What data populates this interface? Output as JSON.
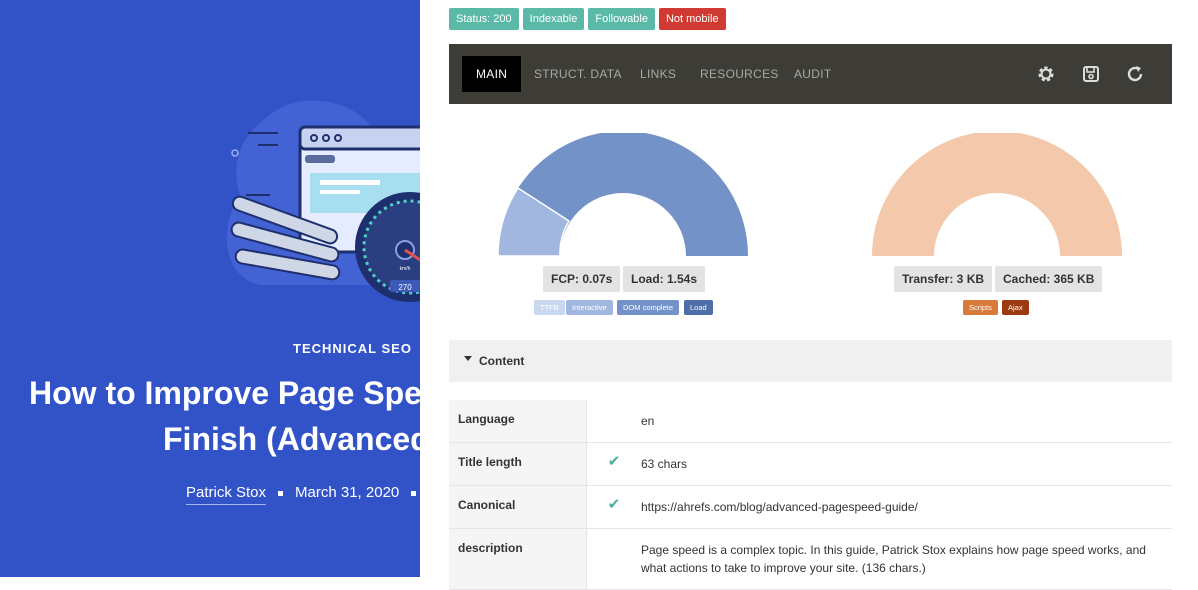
{
  "article": {
    "category": "TECHNICAL SEO",
    "title_line1": "How to Improve Page Spe",
    "title_line2": "Finish (Advanced",
    "author": "Patrick Stox",
    "date": "March 31, 2020",
    "illustration": {
      "speed_value": "270",
      "unit": "km/h"
    }
  },
  "badges": [
    {
      "label": "Status: 200",
      "color": "#5bb9a8"
    },
    {
      "label": "Indexable",
      "color": "#5bb9a8"
    },
    {
      "label": "Followable",
      "color": "#5bb9a8"
    },
    {
      "label": "Not mobile",
      "color": "#d03a32"
    }
  ],
  "tabs": [
    "MAIN",
    "STRUCT. DATA",
    "LINKS",
    "RESOURCES",
    "AUDIT"
  ],
  "active_tab": "MAIN",
  "toolbar_icons": [
    "gear-icon",
    "save-icon",
    "refresh-icon"
  ],
  "timing": {
    "fcp": "FCP: 0.07s",
    "load": "Load: 1.54s",
    "legend": [
      {
        "label": "TTFB",
        "color": "#c9d7ef"
      },
      {
        "label": "Interactive",
        "color": "#a1b7e0"
      },
      {
        "label": "DOM complete",
        "color": "#7393c8"
      },
      {
        "label": "Load",
        "color": "#4d6ea8"
      }
    ]
  },
  "transfer": {
    "transfer": "Transfer: 3 KB",
    "cached": "Cached: 365 KB",
    "legend": [
      {
        "label": "Scripts",
        "color": "#d97a3a"
      },
      {
        "label": "Ajax",
        "color": "#9e3a12"
      }
    ]
  },
  "content_section": {
    "label": "Content",
    "rows": [
      {
        "key": "Language",
        "check": false,
        "value": "en"
      },
      {
        "key": "Title length",
        "check": true,
        "value": "63 chars"
      },
      {
        "key": "Canonical",
        "check": true,
        "value": "https://ahrefs.com/blog/advanced-pagespeed-guide/"
      },
      {
        "key": "description",
        "check": false,
        "value": "Page speed is a complex topic. In this guide, Patrick Stox explains how page speed works, and what actions to take to improve your site. (136 chars.)"
      }
    ]
  }
}
